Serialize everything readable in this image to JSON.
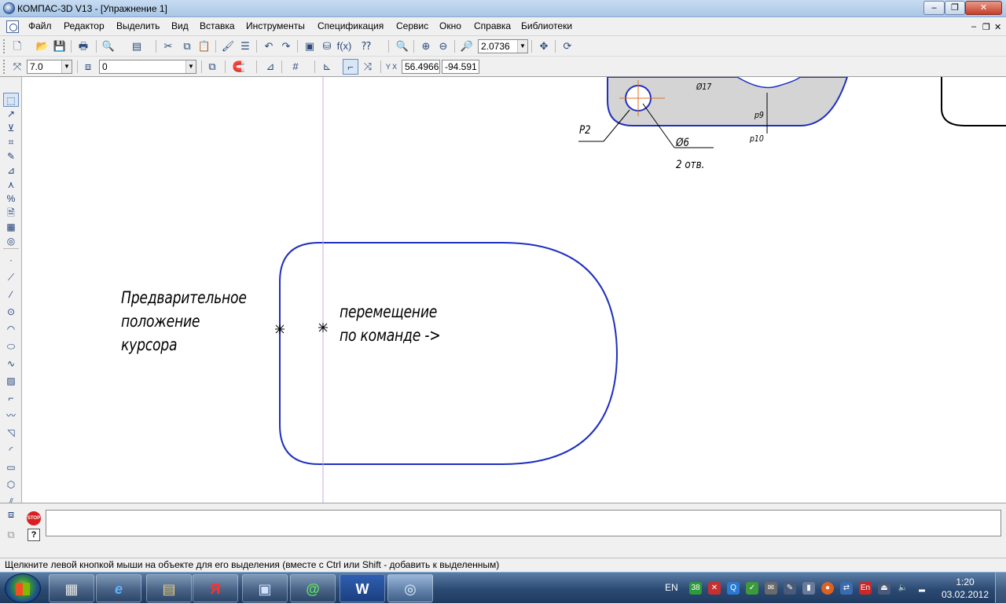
{
  "window": {
    "title": "КОМПАС-3D V13 - [Упражнение 1]",
    "min_glyph": "–",
    "max_glyph": "❐",
    "close_glyph": "✕"
  },
  "menu": {
    "items": [
      "Файл",
      "Редактор",
      "Выделить",
      "Вид",
      "Вставка",
      "Инструменты",
      "Спецификация",
      "Сервис",
      "Окно",
      "Справка",
      "Библиотеки"
    ],
    "mdi_min": "–",
    "mdi_restore": "❐",
    "mdi_close": "✕"
  },
  "toolbar": {
    "zoom_value": "2.0736",
    "step_value": "7.0",
    "layer_value": "0",
    "coord_x": "56.4966",
    "coord_y": "-94.591",
    "coord_label": "Y X"
  },
  "drawing": {
    "label_p2": "P2",
    "label_dia6": "Ø6",
    "label_2holes": "2 отв.",
    "label_p9": "p9",
    "label_p10": "p10",
    "label_d17": "Ø17",
    "note_left": [
      "Предварительное",
      "положение",
      "курсора"
    ],
    "note_right": [
      "перемещение",
      "по команде ->"
    ],
    "line_color": "#1f2fbf",
    "cursor_line_color": "#c8a8d8",
    "fill_color": "#d4d4d4",
    "center_color": "#e07020"
  },
  "status": {
    "text": "Щелкните левой кнопкой мыши на объекте для его выделения (вместе с Ctrl или Shift - добавить к выделенным)"
  },
  "command": {
    "stop_label": "STOP",
    "help_label": "?"
  },
  "taskbar": {
    "apps": [
      {
        "name": "calculator",
        "glyph": "▦"
      },
      {
        "name": "internet-explorer",
        "glyph": "e"
      },
      {
        "name": "explorer",
        "glyph": "▤"
      },
      {
        "name": "yandex",
        "glyph": "Я"
      },
      {
        "name": "media-center",
        "glyph": "▣"
      },
      {
        "name": "mail-agent",
        "glyph": "@"
      },
      {
        "name": "word",
        "glyph": "W"
      },
      {
        "name": "kompas",
        "glyph": "◎"
      }
    ],
    "lang": "EN",
    "tray_badge": "38",
    "tray_lang": "En",
    "time": "1:20",
    "date": "03.02.2012"
  }
}
